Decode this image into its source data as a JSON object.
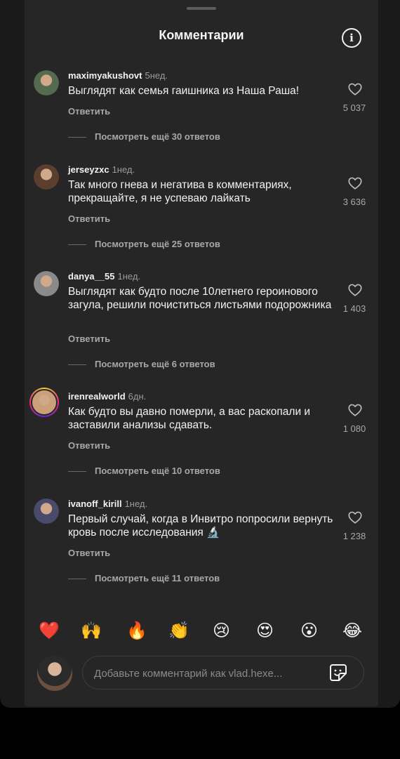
{
  "header": {
    "title": "Комментарии",
    "info_icon": "info-icon"
  },
  "comments": [
    {
      "username": "maximyakushovt",
      "time": "5нед.",
      "text": "Выглядят как семья гаишника из Наша Раша!",
      "reply_label": "Ответить",
      "likes": "5 037",
      "view_replies": "Посмотреть ещё 30 ответов",
      "avatar_color": "#556b4f"
    },
    {
      "username": "jerseyzxc",
      "time": "1нед.",
      "text": "Так много гнева и негатива в комментариях, прекращайте, я не успеваю лайкать",
      "reply_label": "Ответить",
      "likes": "3 636",
      "view_replies": "Посмотреть ещё 25 ответов",
      "avatar_color": "#5a3e2e"
    },
    {
      "username": "danya__55",
      "time": "1нед.",
      "text": "Выглядят как будто после 10летнего героинового загула, решили почиститься листьями подорожника",
      "reply_label": "Ответить",
      "likes": "1 403",
      "view_replies": "Посмотреть ещё 6 ответов",
      "avatar_color": "#8a8a8a"
    },
    {
      "username": "irenrealworld",
      "time": "6дн.",
      "text": "Как будто вы давно померли, а вас раскопали и заставили анализы сдавать.",
      "reply_label": "Ответить",
      "likes": "1 080",
      "view_replies": "Посмотреть ещё 10 ответов",
      "avatar_color": "#c9a07a"
    },
    {
      "username": "ivanoff_kirill",
      "time": "1нед.",
      "text": "Первый случай, когда в Инвитро попросили вернуть кровь после исследования 🔬",
      "reply_label": "Ответить",
      "likes": "1 238",
      "view_replies": "Посмотреть ещё 11 ответов",
      "avatar_color": "#4a4a6a"
    }
  ],
  "emoji_bar": [
    "❤️",
    "🙌",
    "🔥",
    "👏",
    "😢",
    "😍",
    "😮",
    "😂"
  ],
  "composer": {
    "placeholder": "Добавьте комментарий как vlad.hexe...",
    "sticker_icon": "sticker-icon"
  },
  "colors": {
    "sheet_bg": "#262626",
    "text_primary": "#f2f2f2",
    "text_secondary": "#a8a8a8"
  }
}
